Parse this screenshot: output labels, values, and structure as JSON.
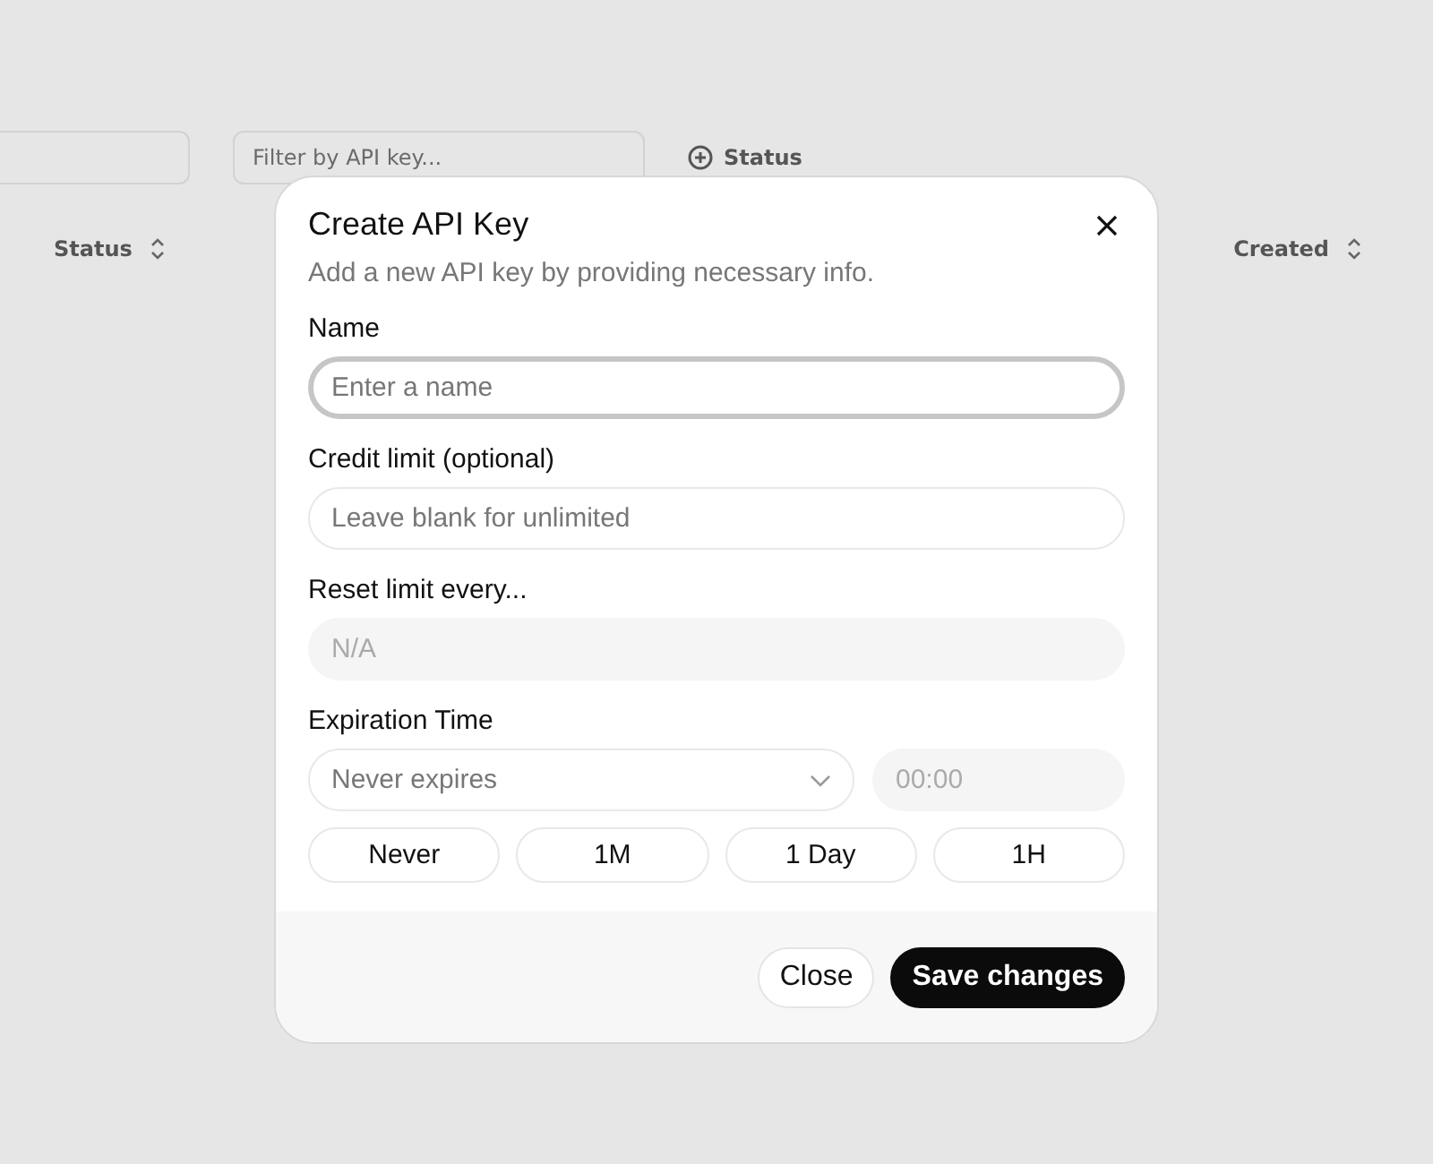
{
  "background": {
    "filter_placeholder": "Filter by API key...",
    "status_filter": "Status",
    "columns": [
      "Status",
      "Created"
    ]
  },
  "dialog": {
    "title": "Create API Key",
    "subtitle": "Add a new API key by providing necessary info.",
    "fields": [
      {
        "label": "Name",
        "placeholder": "Enter a name",
        "focused": true,
        "disabled": false
      },
      {
        "label": "Credit limit (optional)",
        "placeholder": "Leave blank for unlimited",
        "focused": false,
        "disabled": false
      },
      {
        "label": "Reset limit every...",
        "placeholder": "N/A",
        "focused": false,
        "disabled": true
      }
    ],
    "expiration": {
      "label": "Expiration Time",
      "select_placeholder": "Never expires",
      "time_placeholder": "00:00",
      "time_disabled": true,
      "presets": [
        "Never",
        "1M",
        "1 Day",
        "1H"
      ]
    },
    "buttons": [
      {
        "label": "Close",
        "kind": "secondary"
      },
      {
        "label": "Save changes",
        "kind": "primary"
      }
    ]
  }
}
